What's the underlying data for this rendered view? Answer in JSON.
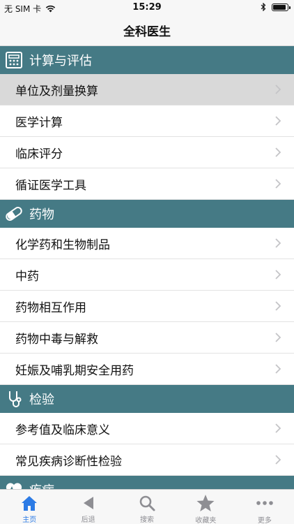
{
  "status": {
    "carrier": "无 SIM 卡",
    "time": "15:29",
    "battery_level": 0.9
  },
  "nav": {
    "title": "全科医生"
  },
  "sections": [
    {
      "title": "计算与评估",
      "icon": "calculator-icon",
      "items": [
        {
          "label": "单位及剂量换算",
          "selected": true
        },
        {
          "label": "医学计算"
        },
        {
          "label": "临床评分"
        },
        {
          "label": "循证医学工具"
        }
      ]
    },
    {
      "title": "药物",
      "icon": "pill-icon",
      "items": [
        {
          "label": "化学药和生物制品"
        },
        {
          "label": "中药"
        },
        {
          "label": "药物相互作用"
        },
        {
          "label": "药物中毒与解救"
        },
        {
          "label": "妊娠及哺乳期安全用药"
        }
      ]
    },
    {
      "title": "检验",
      "icon": "stethoscope-icon",
      "items": [
        {
          "label": "参考值及临床意义"
        },
        {
          "label": "常见疾病诊断性检验"
        }
      ]
    },
    {
      "title": "疾病",
      "icon": "heart-icon",
      "items": []
    }
  ],
  "tabbar": {
    "tabs": [
      {
        "label": "主页",
        "icon": "home-icon",
        "active": true
      },
      {
        "label": "后退",
        "icon": "back-arrow-icon"
      },
      {
        "label": "搜索",
        "icon": "search-icon"
      },
      {
        "label": "收藏夹",
        "icon": "star-icon"
      },
      {
        "label": "更多",
        "icon": "more-icon"
      }
    ]
  },
  "colors": {
    "section_header": "#457a85",
    "selected_row": "#d9d9d9",
    "active_tab": "#2c7be5",
    "inactive_tab": "#8e8e93"
  }
}
